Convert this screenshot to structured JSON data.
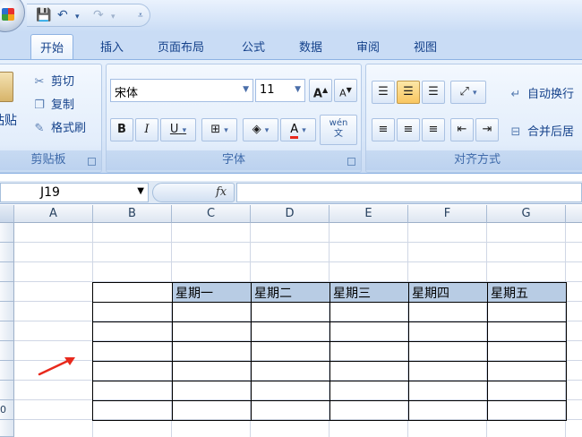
{
  "ribbon_tabs": [
    "开始",
    "插入",
    "页面布局",
    "公式",
    "数据",
    "审阅",
    "视图"
  ],
  "clipboard": {
    "paste": "粘贴",
    "cut": "剪切",
    "copy": "复制",
    "format_painter": "格式刷",
    "group_label": "剪贴板"
  },
  "font": {
    "font_name": "宋体",
    "font_size": "11",
    "group_label": "字体",
    "bold": "B",
    "italic": "I",
    "underline": "U",
    "grow": "A",
    "shrink": "A",
    "color_letter": "A",
    "phonetic": "wén\n文"
  },
  "alignment": {
    "wrap_text": "自动换行",
    "merge_center": "合并后居",
    "group_label": "对齐方式"
  },
  "formula_bar": {
    "name_box": "J19",
    "fx": "fx",
    "value": ""
  },
  "columns": [
    "A",
    "B",
    "C",
    "D",
    "E",
    "F",
    "G"
  ],
  "row_partial_label": "0",
  "table": {
    "headers": [
      "",
      "星期一",
      "星期二",
      "星期三",
      "星期四",
      "星期五"
    ],
    "body_rows": 6
  },
  "colors": {
    "header_fill": "#b8cce4",
    "arrow": "#e8291c",
    "ribbon_text": "#15428b"
  }
}
